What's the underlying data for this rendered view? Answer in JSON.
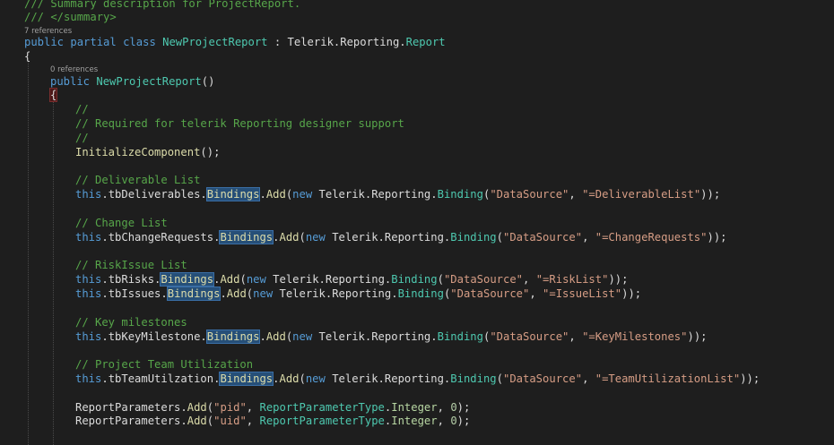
{
  "editor": {
    "colors": {
      "background": "#1e1e1e",
      "keyword": "#569cd6",
      "type": "#4ec9b0",
      "method": "#dcdcaa",
      "string": "#d69d85",
      "comment": "#57a64a",
      "number": "#b5cea8",
      "selection": "#264f78"
    },
    "code_lens": {
      "class_refs": "7 references",
      "ctor_refs": "0 references"
    },
    "lines": [
      {
        "tokens": [
          {
            "t": "/// Summary description for ProjectReport.",
            "c": "cm"
          }
        ]
      },
      {
        "tokens": [
          {
            "t": "/// </summary>",
            "c": "cm"
          }
        ]
      },
      {
        "tokens": [
          {
            "t": "public",
            "c": "kw"
          },
          {
            "t": " ",
            "c": "pl"
          },
          {
            "t": "partial",
            "c": "kw"
          },
          {
            "t": " ",
            "c": "pl"
          },
          {
            "t": "class",
            "c": "kw"
          },
          {
            "t": " ",
            "c": "pl"
          },
          {
            "t": "NewProjectReport",
            "c": "ty"
          },
          {
            "t": " : Telerik.Reporting.",
            "c": "pl"
          },
          {
            "t": "Report",
            "c": "ty"
          }
        ]
      },
      {
        "tokens": [
          {
            "t": "{",
            "c": "pl"
          }
        ]
      },
      {
        "tokens": [
          {
            "t": "public",
            "c": "kw"
          },
          {
            "t": " ",
            "c": "pl"
          },
          {
            "t": "NewProjectReport",
            "c": "ty"
          },
          {
            "t": "()",
            "c": "pl"
          }
        ]
      },
      {
        "tokens": [
          {
            "t": "{",
            "c": "brace"
          }
        ]
      },
      {
        "tokens": [
          {
            "t": "//",
            "c": "cm"
          }
        ]
      },
      {
        "tokens": [
          {
            "t": "// Required for telerik Reporting designer support",
            "c": "cm"
          }
        ]
      },
      {
        "tokens": [
          {
            "t": "//",
            "c": "cm"
          }
        ]
      },
      {
        "tokens": [
          {
            "t": "InitializeComponent",
            "c": "fn"
          },
          {
            "t": "();",
            "c": "pl"
          }
        ]
      },
      {
        "tokens": [
          {
            "t": "// Deliverable List",
            "c": "cm"
          }
        ]
      },
      {
        "tokens": [
          {
            "t": "this",
            "c": "kw"
          },
          {
            "t": ".tbDeliverables.",
            "c": "pl"
          },
          {
            "t": "Bindings",
            "c": "hl"
          },
          {
            "t": ".",
            "c": "pl"
          },
          {
            "t": "Add",
            "c": "fn"
          },
          {
            "t": "(",
            "c": "pl"
          },
          {
            "t": "new",
            "c": "kw"
          },
          {
            "t": " Telerik.Reporting.",
            "c": "pl"
          },
          {
            "t": "Binding",
            "c": "ty"
          },
          {
            "t": "(",
            "c": "pl"
          },
          {
            "t": "\"DataSource\"",
            "c": "st"
          },
          {
            "t": ", ",
            "c": "pl"
          },
          {
            "t": "\"=DeliverableList\"",
            "c": "st"
          },
          {
            "t": "));",
            "c": "pl"
          }
        ]
      },
      {
        "tokens": [
          {
            "t": "// Change List",
            "c": "cm"
          }
        ]
      },
      {
        "tokens": [
          {
            "t": "this",
            "c": "kw"
          },
          {
            "t": ".tbChangeRequests.",
            "c": "pl"
          },
          {
            "t": "Bindings",
            "c": "hl"
          },
          {
            "t": ".",
            "c": "pl"
          },
          {
            "t": "Add",
            "c": "fn"
          },
          {
            "t": "(",
            "c": "pl"
          },
          {
            "t": "new",
            "c": "kw"
          },
          {
            "t": " Telerik.Reporting.",
            "c": "pl"
          },
          {
            "t": "Binding",
            "c": "ty"
          },
          {
            "t": "(",
            "c": "pl"
          },
          {
            "t": "\"DataSource\"",
            "c": "st"
          },
          {
            "t": ", ",
            "c": "pl"
          },
          {
            "t": "\"=ChangeRequests\"",
            "c": "st"
          },
          {
            "t": "));",
            "c": "pl"
          }
        ]
      },
      {
        "tokens": [
          {
            "t": "// RiskIssue List",
            "c": "cm"
          }
        ]
      },
      {
        "tokens": [
          {
            "t": "this",
            "c": "kw"
          },
          {
            "t": ".tbRisks.",
            "c": "pl"
          },
          {
            "t": "Bindings",
            "c": "hl"
          },
          {
            "t": ".",
            "c": "pl"
          },
          {
            "t": "Add",
            "c": "fn"
          },
          {
            "t": "(",
            "c": "pl"
          },
          {
            "t": "new",
            "c": "kw"
          },
          {
            "t": " Telerik.Reporting.",
            "c": "pl"
          },
          {
            "t": "Binding",
            "c": "ty"
          },
          {
            "t": "(",
            "c": "pl"
          },
          {
            "t": "\"DataSource\"",
            "c": "st"
          },
          {
            "t": ", ",
            "c": "pl"
          },
          {
            "t": "\"=RiskList\"",
            "c": "st"
          },
          {
            "t": "));",
            "c": "pl"
          }
        ]
      },
      {
        "tokens": [
          {
            "t": "this",
            "c": "kw"
          },
          {
            "t": ".tbIssues.",
            "c": "pl"
          },
          {
            "t": "Bindings",
            "c": "hl"
          },
          {
            "t": ".",
            "c": "pl"
          },
          {
            "t": "Add",
            "c": "fn"
          },
          {
            "t": "(",
            "c": "pl"
          },
          {
            "t": "new",
            "c": "kw"
          },
          {
            "t": " Telerik.Reporting.",
            "c": "pl"
          },
          {
            "t": "Binding",
            "c": "ty"
          },
          {
            "t": "(",
            "c": "pl"
          },
          {
            "t": "\"DataSource\"",
            "c": "st"
          },
          {
            "t": ", ",
            "c": "pl"
          },
          {
            "t": "\"=IssueList\"",
            "c": "st"
          },
          {
            "t": "));",
            "c": "pl"
          }
        ]
      },
      {
        "tokens": [
          {
            "t": "// Key milestones",
            "c": "cm"
          }
        ]
      },
      {
        "tokens": [
          {
            "t": "this",
            "c": "kw"
          },
          {
            "t": ".tbKeyMilestone.",
            "c": "pl"
          },
          {
            "t": "Bindings",
            "c": "hl"
          },
          {
            "t": ".",
            "c": "pl"
          },
          {
            "t": "Add",
            "c": "fn"
          },
          {
            "t": "(",
            "c": "pl"
          },
          {
            "t": "new",
            "c": "kw"
          },
          {
            "t": " Telerik.Reporting.",
            "c": "pl"
          },
          {
            "t": "Binding",
            "c": "ty"
          },
          {
            "t": "(",
            "c": "pl"
          },
          {
            "t": "\"DataSource\"",
            "c": "st"
          },
          {
            "t": ", ",
            "c": "pl"
          },
          {
            "t": "\"=KeyMilestones\"",
            "c": "st"
          },
          {
            "t": "));",
            "c": "pl"
          }
        ]
      },
      {
        "tokens": [
          {
            "t": "// Project Team Utilization",
            "c": "cm"
          }
        ]
      },
      {
        "tokens": [
          {
            "t": "this",
            "c": "kw"
          },
          {
            "t": ".tbTeamUtilzation.",
            "c": "pl"
          },
          {
            "t": "Bindings",
            "c": "hl"
          },
          {
            "t": ".",
            "c": "pl"
          },
          {
            "t": "Add",
            "c": "fn"
          },
          {
            "t": "(",
            "c": "pl"
          },
          {
            "t": "new",
            "c": "kw"
          },
          {
            "t": " Telerik.Reporting.",
            "c": "pl"
          },
          {
            "t": "Binding",
            "c": "ty"
          },
          {
            "t": "(",
            "c": "pl"
          },
          {
            "t": "\"DataSource\"",
            "c": "st"
          },
          {
            "t": ", ",
            "c": "pl"
          },
          {
            "t": "\"=TeamUtilizationList\"",
            "c": "st"
          },
          {
            "t": "));",
            "c": "pl"
          }
        ]
      },
      {
        "tokens": [
          {
            "t": "ReportParameters",
            "c": "pl"
          },
          {
            "t": ".",
            "c": "pl"
          },
          {
            "t": "Add",
            "c": "fn"
          },
          {
            "t": "(",
            "c": "pl"
          },
          {
            "t": "\"pid\"",
            "c": "st"
          },
          {
            "t": ", ",
            "c": "pl"
          },
          {
            "t": "ReportParameterType",
            "c": "ty"
          },
          {
            "t": ".",
            "c": "pl"
          },
          {
            "t": "Integer",
            "c": "en"
          },
          {
            "t": ", ",
            "c": "pl"
          },
          {
            "t": "0",
            "c": "nm"
          },
          {
            "t": ");",
            "c": "pl"
          }
        ]
      },
      {
        "tokens": [
          {
            "t": "ReportParameters",
            "c": "pl"
          },
          {
            "t": ".",
            "c": "pl"
          },
          {
            "t": "Add",
            "c": "fn"
          },
          {
            "t": "(",
            "c": "pl"
          },
          {
            "t": "\"uid\"",
            "c": "st"
          },
          {
            "t": ", ",
            "c": "pl"
          },
          {
            "t": "ReportParameterType",
            "c": "ty"
          },
          {
            "t": ".",
            "c": "pl"
          },
          {
            "t": "Integer",
            "c": "en"
          },
          {
            "t": ", ",
            "c": "pl"
          },
          {
            "t": "0",
            "c": "nm"
          },
          {
            "t": ");",
            "c": "pl"
          }
        ]
      }
    ]
  }
}
